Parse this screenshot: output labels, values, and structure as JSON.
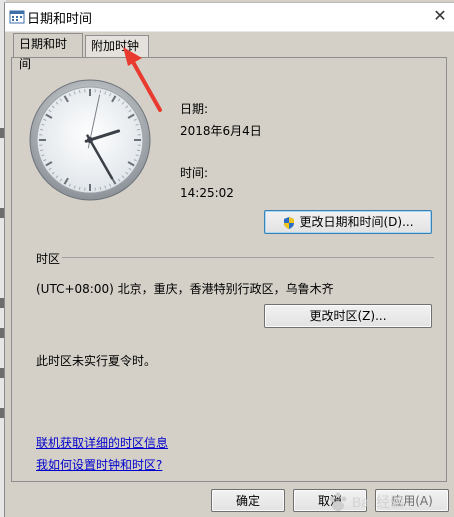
{
  "window": {
    "title": "日期和时间",
    "close_glyph": "✕"
  },
  "tabs": [
    {
      "label": "日期和时间",
      "active": true
    },
    {
      "label": "附加时钟",
      "active": false
    }
  ],
  "datetime": {
    "date_label": "日期:",
    "date_value": "2018年6月4日",
    "time_label": "时间:",
    "time_value": "14:25:02",
    "change_button": "更改日期和时间(D)...",
    "clock": {
      "hour": 14,
      "minute": 25,
      "second": 2
    }
  },
  "timezone": {
    "section_label": "时区",
    "value": "(UTC+08:00) 北京，重庆，香港特别行政区，乌鲁木齐",
    "change_button": "更改时区(Z)...",
    "dst_note": "此时区未实行夏令时。"
  },
  "links": {
    "online_info": "联机获取详细的时区信息",
    "how_to": "我如何设置时钟和时区?"
  },
  "footer": {
    "ok": "确定",
    "cancel": "取消",
    "apply": "应用(A)"
  },
  "colors": {
    "link": "#0000cc",
    "annotation_arrow": "#e83a2e"
  },
  "icons": [
    "datetime-app-icon",
    "close-icon",
    "shield-icon",
    "analog-clock",
    "red-arrow"
  ]
}
